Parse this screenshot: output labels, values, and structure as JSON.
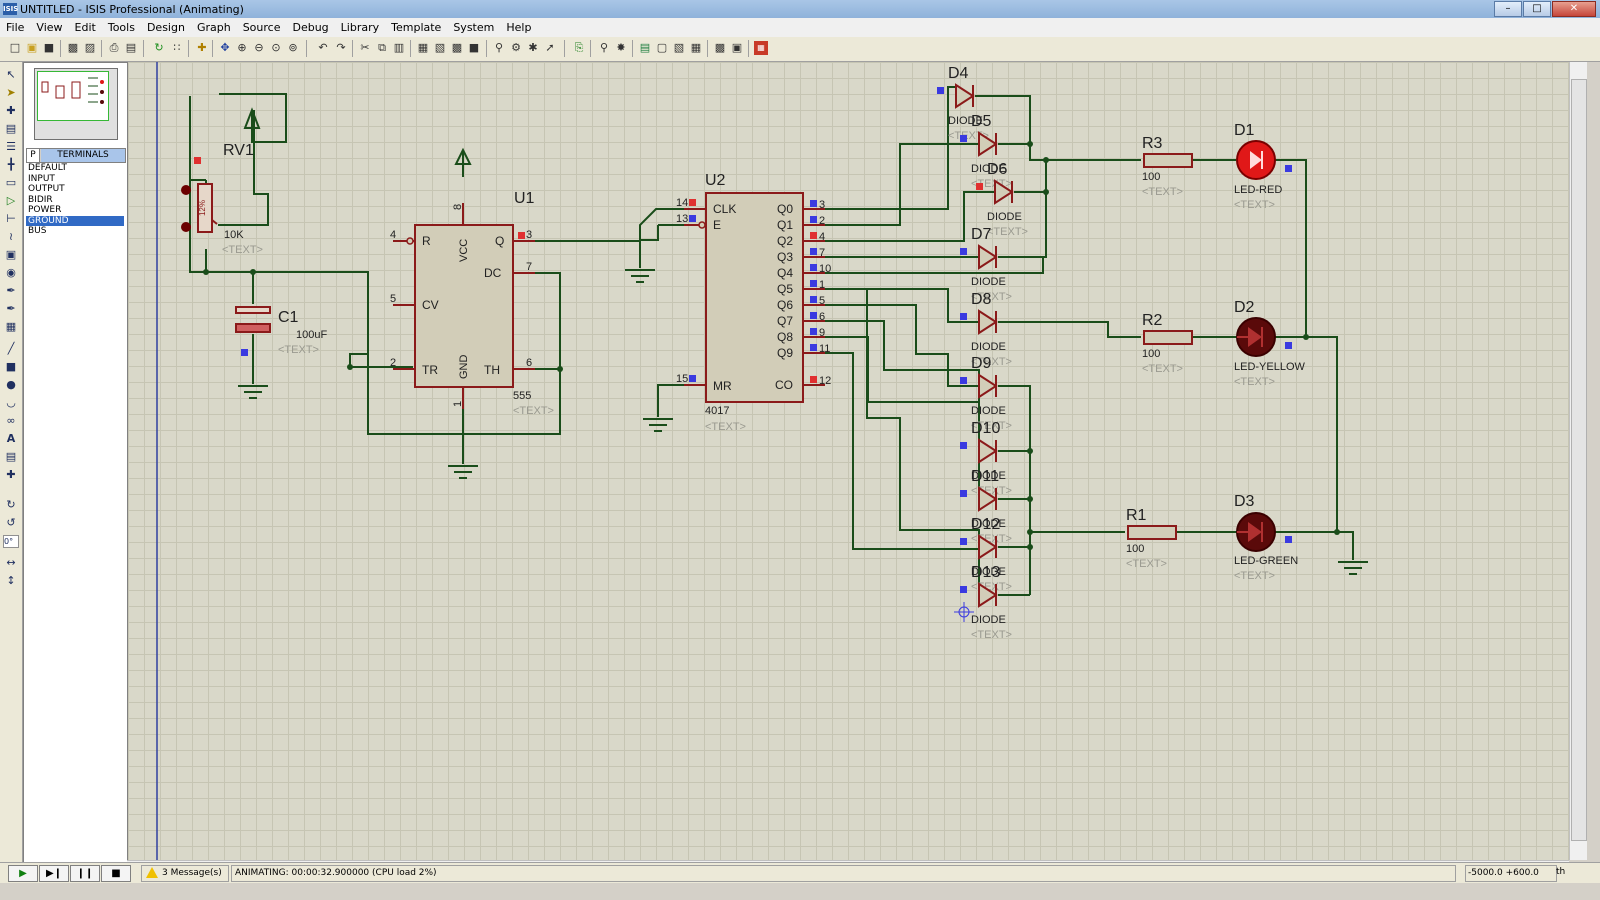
{
  "window": {
    "title": "UNTITLED - ISIS Professional (Animating)",
    "app_icon": "ISIS",
    "controls": [
      "minimize-icon",
      "maximize-icon",
      "close-icon"
    ]
  },
  "menu": [
    "File",
    "View",
    "Edit",
    "Tools",
    "Design",
    "Graph",
    "Source",
    "Debug",
    "Library",
    "Template",
    "System",
    "Help"
  ],
  "sidebar": {
    "mode_button": "P",
    "header": "TERMINALS",
    "items": [
      "DEFAULT",
      "INPUT",
      "OUTPUT",
      "BIDIR",
      "POWER",
      "GROUND",
      "BUS"
    ],
    "selected": "GROUND",
    "rotation_value": "0°"
  },
  "schematic": {
    "rv1": {
      "ref": "RV1",
      "value": "10K",
      "text": "<TEXT>",
      "percent": "12%"
    },
    "c1": {
      "ref": "C1",
      "value": "100uF",
      "text": "<TEXT>"
    },
    "u1": {
      "ref": "U1",
      "value": "555",
      "text": "<TEXT>",
      "pins": {
        "R": "R",
        "CV": "CV",
        "TR": "TR",
        "VCC": "VCC",
        "GND": "GND",
        "Q": "Q",
        "DC": "DC",
        "TH": "TH"
      },
      "pin_numbers": {
        "R": "4",
        "CV": "5",
        "TR": "2",
        "VCC": "8",
        "GND": "1",
        "Q": "3",
        "DC": "7",
        "TH": "6"
      }
    },
    "u2": {
      "ref": "U2",
      "value": "4017",
      "text": "<TEXT>",
      "left_pins": [
        {
          "name": "CLK",
          "num": "14"
        },
        {
          "name": "E",
          "num": "13"
        },
        {
          "name": "MR",
          "num": "15"
        }
      ],
      "right_pins": [
        {
          "name": "Q0",
          "num": "3"
        },
        {
          "name": "Q1",
          "num": "2"
        },
        {
          "name": "Q2",
          "num": "4"
        },
        {
          "name": "Q3",
          "num": "7"
        },
        {
          "name": "Q4",
          "num": "10"
        },
        {
          "name": "Q5",
          "num": "1"
        },
        {
          "name": "Q6",
          "num": "5"
        },
        {
          "name": "Q7",
          "num": "6"
        },
        {
          "name": "Q8",
          "num": "9"
        },
        {
          "name": "Q9",
          "num": "11"
        },
        {
          "name": "CO",
          "num": "12"
        }
      ]
    },
    "diodes": [
      {
        "ref": "D4",
        "value": "DIODE",
        "text": "<TEXT>"
      },
      {
        "ref": "D5",
        "value": "DIODE",
        "text": "<TEXT>"
      },
      {
        "ref": "D6",
        "value": "DIODE",
        "text": "<TEXT>"
      },
      {
        "ref": "D7",
        "value": "DIODE",
        "text": "<TEXT>"
      },
      {
        "ref": "D8",
        "value": "DIODE",
        "text": "<TEXT>"
      },
      {
        "ref": "D9",
        "value": "DIODE",
        "text": "<TEXT>"
      },
      {
        "ref": "D10",
        "value": "DIODE",
        "text": "<TEXT>"
      },
      {
        "ref": "D11",
        "value": "DIODE",
        "text": "<TEXT>"
      },
      {
        "ref": "D12",
        "value": "DIODE",
        "text": "<TEXT>"
      },
      {
        "ref": "D13",
        "value": "DIODE",
        "text": "<TEXT>"
      }
    ],
    "resistors": [
      {
        "ref": "R3",
        "value": "100",
        "text": "<TEXT>"
      },
      {
        "ref": "R2",
        "value": "100",
        "text": "<TEXT>"
      },
      {
        "ref": "R1",
        "value": "100",
        "text": "<TEXT>"
      }
    ],
    "leds": [
      {
        "ref": "D1",
        "value": "LED-RED",
        "text": "<TEXT>",
        "lit": true
      },
      {
        "ref": "D2",
        "value": "LED-YELLOW",
        "text": "<TEXT>",
        "lit": false
      },
      {
        "ref": "D3",
        "value": "LED-GREEN",
        "text": "<TEXT>",
        "lit": false
      }
    ]
  },
  "status": {
    "messages": "3 Message(s)",
    "animation": "ANIMATING: 00:00:32.900000 (CPU load 2%)",
    "coords": "-5000.0   +600.0",
    "unit": "th"
  },
  "colors": {
    "wire": "#1a4d1a",
    "component": "#8b1a1a",
    "canvas": "#d9d8c9",
    "logic_high": "#e03030",
    "logic_low": "#3a3ae0",
    "text_gray": "#9a9a90",
    "led_red_lit": "#e01818",
    "led_off": "#5a0a0a"
  }
}
